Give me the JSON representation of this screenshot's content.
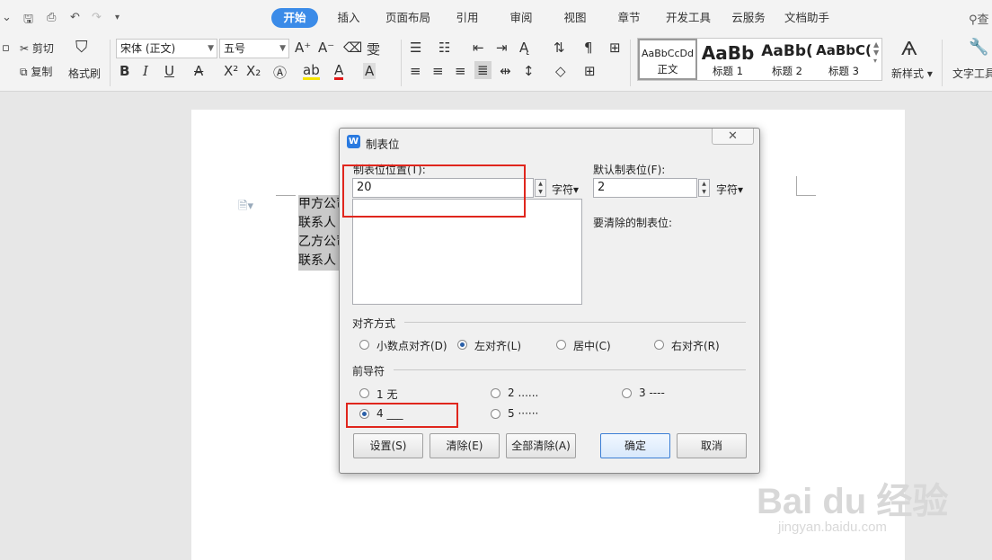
{
  "menubar": {
    "tabs": [
      "开始",
      "插入",
      "页面布局",
      "引用",
      "审阅",
      "视图",
      "章节",
      "开发工具",
      "云服务",
      "文档助手"
    ],
    "search_icon": "search-icon"
  },
  "ribbon": {
    "cut": "剪切",
    "copy": "复制",
    "format_painter": "格式刷",
    "font_name": "宋体 (正文)",
    "font_size": "五号",
    "styles": [
      {
        "preview": "AaBbCcDd",
        "label": "正文"
      },
      {
        "preview": "AaBb",
        "label": "标题 1"
      },
      {
        "preview": "AaBb(",
        "label": "标题 2"
      },
      {
        "preview": "AaBbC(",
        "label": "标题 3"
      }
    ],
    "new_style": "新样式",
    "text_tools": "文字工具"
  },
  "document": {
    "lines": [
      "甲方公司",
      "联系人",
      "乙方公司",
      "联系人"
    ]
  },
  "dialog": {
    "title": "制表位",
    "tab_position_label": "制表位位置(T):",
    "tab_position_value": "20",
    "tab_position_unit": "字符▾",
    "default_tab_label": "默认制表位(F):",
    "default_tab_value": "2",
    "default_tab_unit": "字符▾",
    "clear_label": "要清除的制表位:",
    "alignment_group": "对齐方式",
    "alignment_options": [
      "小数点对齐(D)",
      "左对齐(L)",
      "居中(C)",
      "右对齐(R)"
    ],
    "alignment_selected": "左对齐(L)",
    "leader_group": "前导符",
    "leader_options": [
      "1 无",
      "2 ......",
      "3 ----",
      "4 ___",
      "5 ······"
    ],
    "leader_selected": "4 ___",
    "buttons": {
      "set": "设置(S)",
      "clear": "清除(E)",
      "clear_all": "全部清除(A)",
      "ok": "确定",
      "cancel": "取消"
    },
    "close_symbol": "✕"
  },
  "watermark": {
    "brand": "Bai du 经验",
    "url": "jingyan.baidu.com"
  },
  "colors": {
    "accent": "#3b8be8",
    "highlight_box": "#e0261d"
  }
}
